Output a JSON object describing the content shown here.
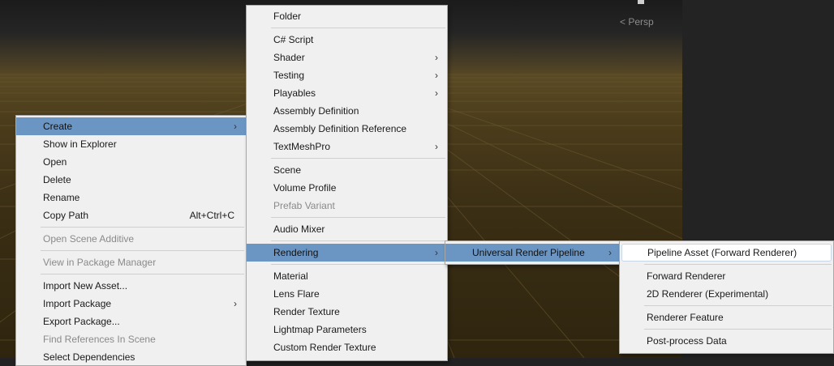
{
  "scene": {
    "view_label": "< Persp"
  },
  "context_menu": {
    "items": [
      {
        "label": "Create",
        "submenu": true,
        "highlighted": true
      },
      {
        "label": "Show in Explorer"
      },
      {
        "label": "Open"
      },
      {
        "label": "Delete"
      },
      {
        "label": "Rename"
      },
      {
        "label": "Copy Path",
        "shortcut": "Alt+Ctrl+C"
      },
      {
        "label": "Open Scene Additive",
        "disabled": true
      },
      {
        "label": "View in Package Manager",
        "disabled": true
      },
      {
        "label": "Import New Asset..."
      },
      {
        "label": "Import Package",
        "submenu": true
      },
      {
        "label": "Export Package..."
      },
      {
        "label": "Find References In Scene",
        "disabled": true
      },
      {
        "label": "Select Dependencies"
      }
    ]
  },
  "create_menu": {
    "items": [
      {
        "label": "Folder"
      },
      {
        "label": "C# Script"
      },
      {
        "label": "Shader",
        "submenu": true
      },
      {
        "label": "Testing",
        "submenu": true
      },
      {
        "label": "Playables",
        "submenu": true
      },
      {
        "label": "Assembly Definition"
      },
      {
        "label": "Assembly Definition Reference"
      },
      {
        "label": "TextMeshPro",
        "submenu": true
      },
      {
        "label": "Scene"
      },
      {
        "label": "Volume Profile"
      },
      {
        "label": "Prefab Variant",
        "disabled": true
      },
      {
        "label": "Audio Mixer"
      },
      {
        "label": "Rendering",
        "submenu": true,
        "highlighted": true
      },
      {
        "label": "Material"
      },
      {
        "label": "Lens Flare"
      },
      {
        "label": "Render Texture"
      },
      {
        "label": "Lightmap Parameters"
      },
      {
        "label": "Custom Render Texture"
      }
    ]
  },
  "rendering_menu": {
    "items": [
      {
        "label": "Universal Render Pipeline",
        "submenu": true,
        "highlighted": true
      }
    ]
  },
  "urp_menu": {
    "items": [
      {
        "label": "Pipeline Asset (Forward Renderer)",
        "hovered": true
      },
      {
        "label": "Forward Renderer"
      },
      {
        "label": "2D Renderer (Experimental)"
      },
      {
        "label": "Renderer Feature"
      },
      {
        "label": "Post-process Data"
      }
    ]
  },
  "icons": {
    "submenu_arrow": "chevron-right-icon"
  }
}
